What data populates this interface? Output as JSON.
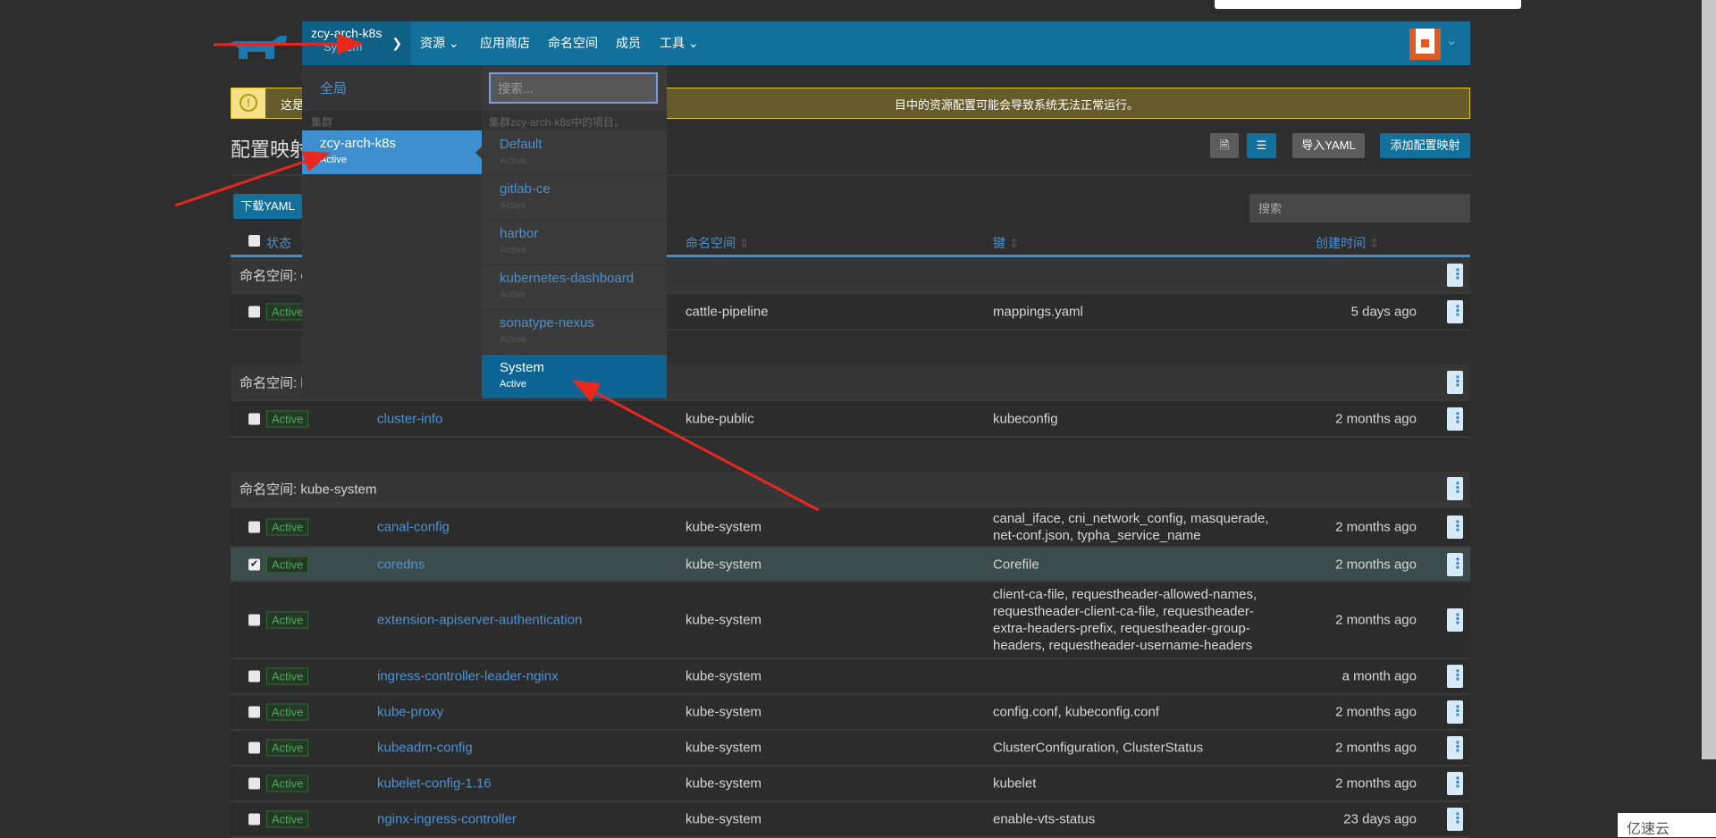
{
  "nav": {
    "cluster_name": "zcy-arch-k8s",
    "project_name": "System",
    "items": [
      "资源",
      "应用商店",
      "命名空间",
      "成员",
      "工具"
    ]
  },
  "banner": {
    "text_start": "这是",
    "text_end": "目中的资源配置可能会导致系统无法正常运行。"
  },
  "page": {
    "title": "配置映射",
    "import_yaml": "导入YAML",
    "add_configmap": "添加配置映射",
    "download_yaml": "下载YAML",
    "search_placeholder": "搜索"
  },
  "table": {
    "headers": {
      "state": "状态",
      "namespace": "命名空间",
      "keys": "键",
      "created": "创建时间"
    },
    "groups": [
      {
        "label": "命名空间: cattle-pipeline",
        "rows": [
          {
            "state": "Active",
            "name": "",
            "namespace": "cattle-pipeline",
            "keys": "mappings.yaml",
            "created": "5 days ago",
            "checked": false
          }
        ]
      },
      {
        "label": "命名空间: kube-public",
        "rows": [
          {
            "state": "Active",
            "name": "cluster-info",
            "namespace": "kube-public",
            "keys": "kubeconfig",
            "created": "2 months ago",
            "checked": false
          }
        ]
      },
      {
        "label": "命名空间: kube-system",
        "rows": [
          {
            "state": "Active",
            "name": "canal-config",
            "namespace": "kube-system",
            "keys": "canal_iface, cni_network_config, masquerade, net-conf.json, typha_service_name",
            "created": "2 months ago",
            "checked": false
          },
          {
            "state": "Active",
            "name": "coredns",
            "namespace": "kube-system",
            "keys": "Corefile",
            "created": "2 months ago",
            "checked": true
          },
          {
            "state": "Active",
            "name": "extension-apiserver-authentication",
            "namespace": "kube-system",
            "keys": "client-ca-file, requestheader-allowed-names, requestheader-client-ca-file, requestheader-extra-headers-prefix, requestheader-group-headers, requestheader-username-headers",
            "created": "2 months ago",
            "checked": false
          },
          {
            "state": "Active",
            "name": "ingress-controller-leader-nginx",
            "namespace": "kube-system",
            "keys": "",
            "created": "a month ago",
            "checked": false
          },
          {
            "state": "Active",
            "name": "kube-proxy",
            "namespace": "kube-system",
            "keys": "config.conf, kubeconfig.conf",
            "created": "2 months ago",
            "checked": false
          },
          {
            "state": "Active",
            "name": "kubeadm-config",
            "namespace": "kube-system",
            "keys": "ClusterConfiguration, ClusterStatus",
            "created": "2 months ago",
            "checked": false
          },
          {
            "state": "Active",
            "name": "kubelet-config-1.16",
            "namespace": "kube-system",
            "keys": "kubelet",
            "created": "2 months ago",
            "checked": false
          },
          {
            "state": "Active",
            "name": "nginx-ingress-controller",
            "namespace": "kube-system",
            "keys": "enable-vts-status",
            "created": "23 days ago",
            "checked": false
          }
        ]
      }
    ]
  },
  "dropdown": {
    "global": "全局",
    "cluster_header": "集群",
    "cluster": {
      "name": "zcy-arch-k8s",
      "state": "Active"
    },
    "search_placeholder": "搜索...",
    "project_header": "集群zcy-arch-k8s中的项目。",
    "projects": [
      {
        "name": "Default",
        "state": "Active"
      },
      {
        "name": "gitlab-ce",
        "state": "Active"
      },
      {
        "name": "harbor",
        "state": "Active"
      },
      {
        "name": "kubernetes-dashboard",
        "state": "Active"
      },
      {
        "name": "sonatype-nexus",
        "state": "Active"
      },
      {
        "name": "System",
        "state": "Active",
        "selected": true
      }
    ]
  },
  "watermark": "亿速云",
  "colors": {
    "nav": "#13709a",
    "accent": "#3d8fcf",
    "active_green": "#4bab55",
    "annotation_arrow": "#e8271e"
  }
}
